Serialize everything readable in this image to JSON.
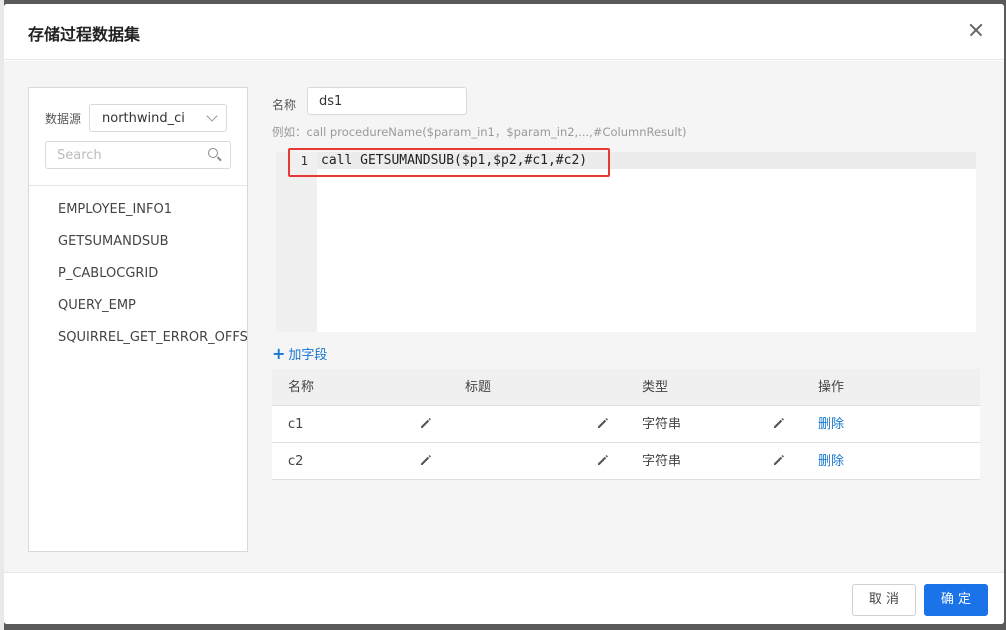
{
  "dialog": {
    "title": "存储过程数据集"
  },
  "left": {
    "datasource_label": "数据源",
    "datasource_value": "northwind_ci",
    "search_placeholder": "Search",
    "procedures": [
      "EMPLOYEE_INFO1",
      "GETSUMANDSUB",
      "P_CABLOCGRID",
      "QUERY_EMP",
      "SQUIRREL_GET_ERROR_OFFSET"
    ]
  },
  "form": {
    "name_label": "名称",
    "name_value": "ds1",
    "example": "例如：call procedureName($param_in1，$param_in2,...,#ColumnResult)"
  },
  "editor": {
    "line_number": "1",
    "code": "call GETSUMANDSUB($p1,$p2,#c1,#c2)"
  },
  "fields": {
    "add_label": "加字段",
    "add_icon": "+",
    "headers": [
      "名称",
      "标题",
      "类型",
      "操作"
    ],
    "rows": [
      {
        "name": "c1",
        "title": "",
        "type": "字符串",
        "action": "删除"
      },
      {
        "name": "c2",
        "title": "",
        "type": "字符串",
        "action": "删除"
      }
    ]
  },
  "footer": {
    "cancel": "取 消",
    "ok": "确 定"
  },
  "colors": {
    "primary": "#1a73e8",
    "link": "#1677d2",
    "highlight_border": "#e53935"
  }
}
